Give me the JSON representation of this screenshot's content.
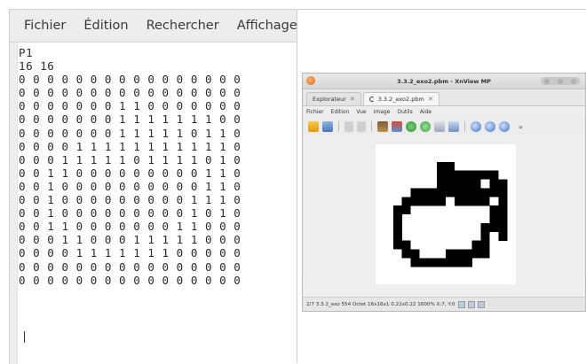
{
  "editor": {
    "menu": [
      "Fichier",
      "Édition",
      "Rechercher",
      "Affichage"
    ],
    "lines": [
      "P1",
      "16 16",
      "0 0 0 0 0 0 0 0 0 0 0 0 0 0 0 0",
      "0 0 0 0 0 0 0 0 0 0 0 0 0 0 0 0",
      "0 0 0 0 0 0 0 1 1 0 0 0 0 0 0 0",
      "0 0 0 0 0 0 0 1 1 1 1 1 1 1 0 0",
      "0 0 0 0 0 0 0 1 1 1 1 1 0 1 1 0",
      "0 0 0 0 1 1 1 1 1 1 1 1 1 1 1 0",
      "0 0 0 1 1 1 1 1 0 1 1 1 1 0 1 0",
      "0 0 1 1 0 0 0 0 0 0 0 0 0 1 1 0",
      "0 0 1 0 0 0 0 0 0 0 0 0 0 1 1 0",
      "0 0 1 0 0 0 0 0 0 0 0 0 1 1 1 0",
      "0 0 1 0 0 0 0 0 0 0 0 0 1 0 1 0",
      "0 0 1 1 0 0 0 0 0 0 0 1 1 0 0 0",
      "0 0 0 1 1 0 0 0 1 1 1 1 1 0 0 0",
      "0 0 0 0 1 1 1 1 1 1 1 0 0 0 0 0",
      "0 0 0 0 0 0 0 0 0 0 0 0 0 0 0 0",
      "0 0 0 0 0 0 0 0 0 0 0 0 0 0 0 0"
    ]
  },
  "viewer": {
    "title": "3.3.2_exo2.pbm - XnView MP",
    "tabs": [
      {
        "label": "Explorateur",
        "close": "✕"
      },
      {
        "label": "3.3.2_exo2.pbm",
        "close": "✕"
      }
    ],
    "menu": [
      "Fichier",
      "Edition",
      "Vue",
      "Image",
      "Outils",
      "Aide"
    ],
    "toolbar_icons": [
      "folder-icon",
      "browse-icon",
      "undo-icon",
      "redo-icon",
      "film-icon",
      "photo-icon",
      "globe-icon",
      "refresh-icon",
      "settings-dropdown-icon",
      "image-adjust-icon",
      "zoom-in-icon",
      "zoom-fit-icon",
      "zoom-out-icon",
      "more-icon"
    ],
    "status": "2/7  3.3.2_exo  554 Octet  16x16x1  0.22x0.22  1600%  X:7, Y:0",
    "colors": {
      "ink": "#000000",
      "paper": "#ffffff",
      "accent": "#e0601a"
    }
  }
}
